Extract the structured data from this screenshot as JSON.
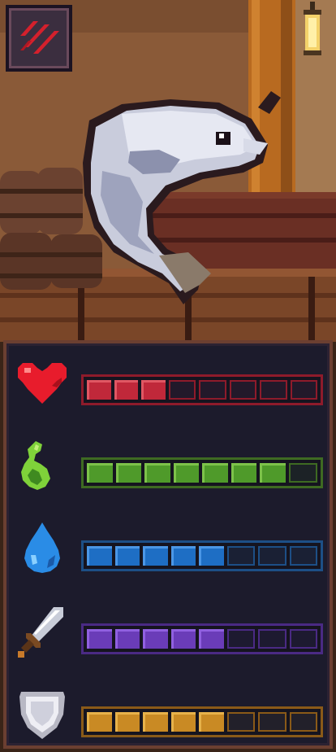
{
  "colors": {
    "health": {
      "fill": "#c0283a",
      "empty": "#22192a",
      "border": "#8e1b2b",
      "hi": "#e05763"
    },
    "stamina": {
      "fill": "#4f9a2a",
      "empty": "#1c2226",
      "border": "#3e6a22",
      "hi": "#7dc24a"
    },
    "water": {
      "fill": "#1e6ec4",
      "empty": "#1a2034",
      "border": "#1d4f86",
      "hi": "#4b97e6"
    },
    "attack": {
      "fill": "#6a3cb8",
      "empty": "#1d1a30",
      "border": "#4a2a84",
      "hi": "#9060e0"
    },
    "defense": {
      "fill": "#c98a24",
      "empty": "#22202a",
      "border": "#8a5a18",
      "hi": "#e7b24a"
    }
  },
  "stats": [
    {
      "id": "health",
      "icon": "heart-icon",
      "value": 3,
      "max": 8
    },
    {
      "id": "stamina",
      "icon": "leaf-icon",
      "value": 7,
      "max": 8
    },
    {
      "id": "water",
      "icon": "water-drop-icon",
      "value": 5,
      "max": 8
    },
    {
      "id": "attack",
      "icon": "sword-icon",
      "value": 5,
      "max": 8
    },
    {
      "id": "defense",
      "icon": "shield-icon",
      "value": 5,
      "max": 8
    }
  ],
  "menu": {
    "icon": "claw-marks-icon"
  }
}
